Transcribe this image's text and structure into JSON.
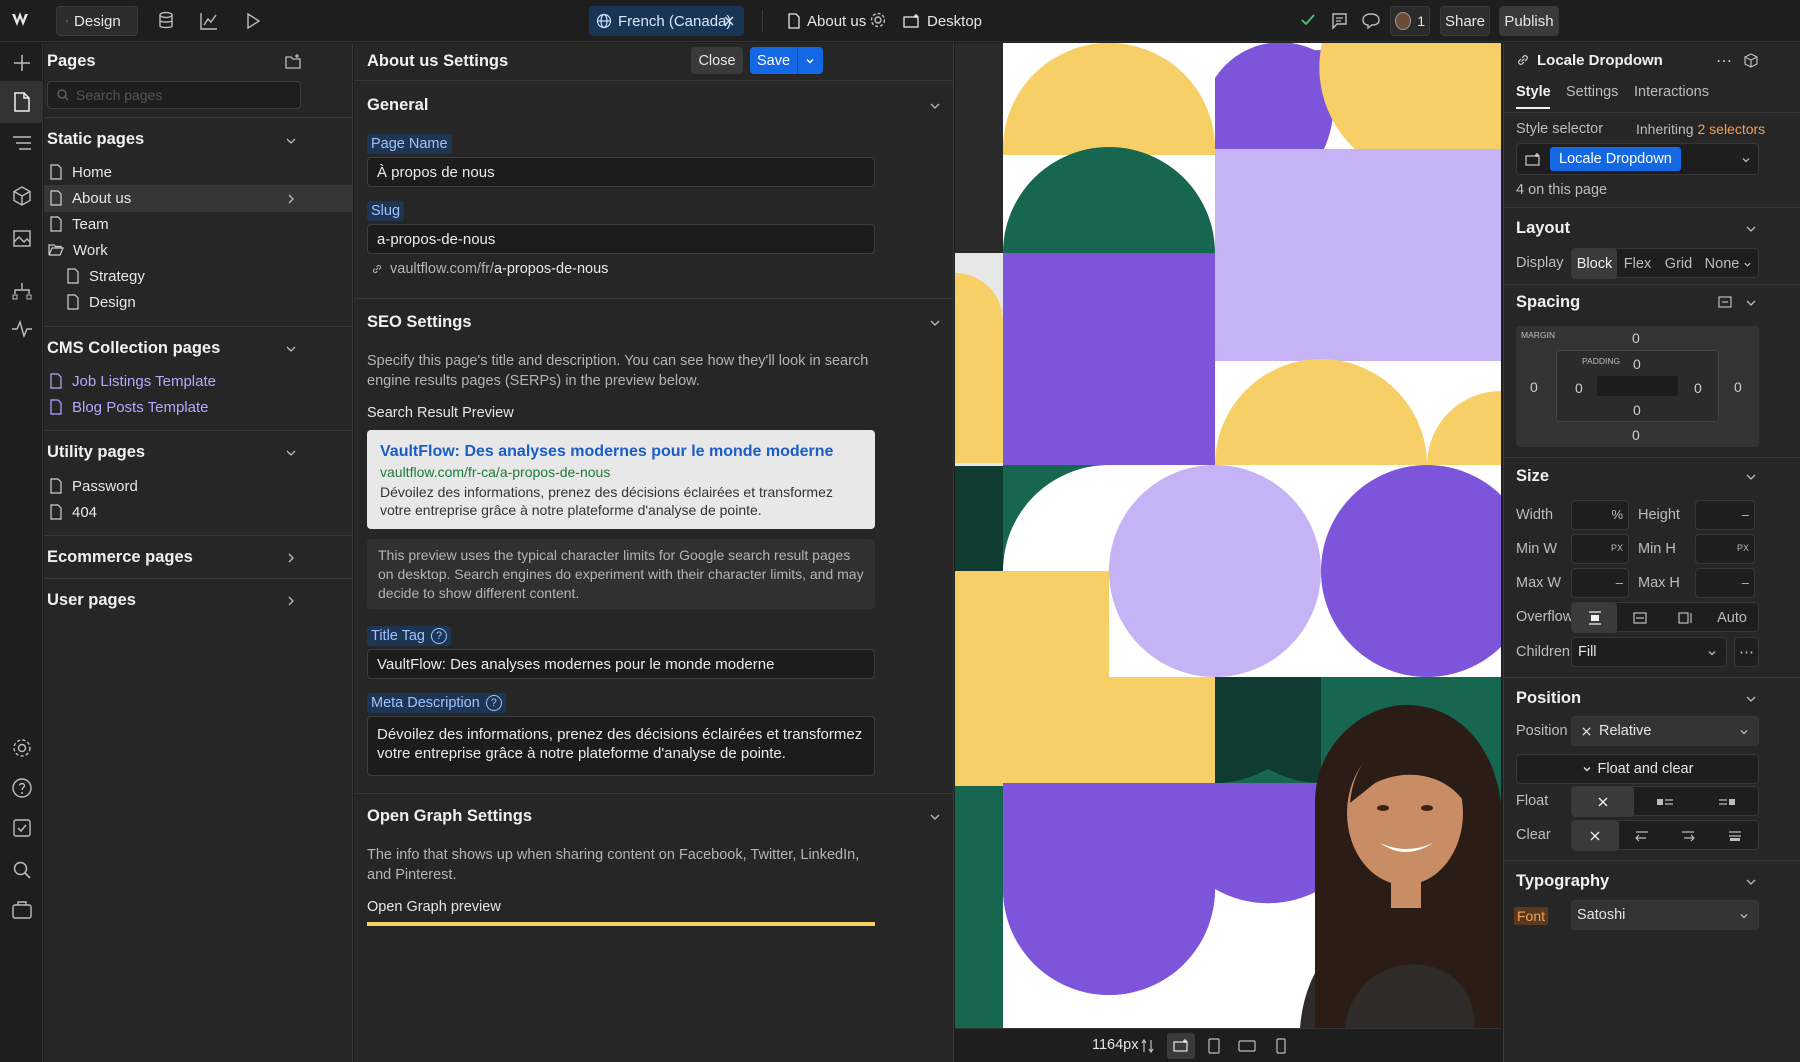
{
  "topbar": {
    "mode_label": "Design",
    "locale_label": "French (Canada)",
    "page_label": "About us",
    "breakpoint_label": "Desktop",
    "user_count": "1",
    "share_label": "Share",
    "publish_label": "Publish"
  },
  "pages": {
    "title": "Pages",
    "search_placeholder": "Search pages",
    "static_title": "Static pages",
    "static_items": [
      "Home",
      "About us",
      "Team",
      "Work",
      "Strategy",
      "Design"
    ],
    "cms_title": "CMS Collection pages",
    "cms_items": [
      "Job Listings Template",
      "Blog Posts Template"
    ],
    "utility_title": "Utility pages",
    "utility_items": [
      "Password",
      "404"
    ],
    "ecommerce_title": "Ecommerce pages",
    "user_title": "User pages"
  },
  "settings": {
    "title": "About us Settings",
    "close_label": "Close",
    "save_label": "Save",
    "general_title": "General",
    "page_name_label": "Page Name",
    "page_name_value": "À propos de nous",
    "slug_label": "Slug",
    "slug_value": "a-propos-de-nous",
    "url_prefix": "vaultflow.com/fr/",
    "url_slug": "a-propos-de-nous",
    "seo_title": "SEO Settings",
    "seo_desc": "Specify this page's title and description. You can see how they'll look in search engine results pages (SERPs) in the preview below.",
    "search_preview_label": "Search Result Preview",
    "serp_title": "VaultFlow: Des analyses modernes pour le monde moderne",
    "serp_url": "vaultflow.com/fr-ca/a-propos-de-nous",
    "serp_desc": "Dévoilez des informations, prenez des décisions éclairées et transformez votre entreprise grâce à notre plateforme d'analyse de pointe.",
    "preview_note": "This preview uses the typical character limits for Google search result pages on desktop. Search engines do experiment with their character limits, and may decide to show different content.",
    "title_tag_label": "Title Tag",
    "title_tag_value": "VaultFlow: Des analyses modernes pour le monde moderne",
    "meta_label": "Meta Description",
    "meta_value": "Dévoilez des informations, prenez des décisions éclairées et transformez votre entreprise grâce à notre plateforme d'analyse de pointe.",
    "og_title": "Open Graph Settings",
    "og_desc": "The info that shows up when sharing content on Facebook, Twitter, LinkedIn, and Pinterest.",
    "og_preview_label": "Open Graph preview"
  },
  "canvas": {
    "width_readout": "1164px",
    "colors": {
      "yellow": "#f6cf66",
      "purple": "#7d55db",
      "lilac": "#c6b3f6",
      "green": "#17664f",
      "darkgreen": "#0f3b31",
      "white": "#ffffff"
    }
  },
  "style": {
    "element_name": "Locale Dropdown",
    "tabs": [
      "Style",
      "Settings",
      "Interactions"
    ],
    "selector_label": "Style selector",
    "inheriting_prefix": "Inheriting",
    "inheriting_count": "2 selectors",
    "selector_chip": "Locale Dropdown",
    "on_page": "4 on this page",
    "layout_title": "Layout",
    "display_label": "Display",
    "display_options": [
      "Block",
      "Flex",
      "Grid",
      "None"
    ],
    "spacing_title": "Spacing",
    "margin_label": "MARGIN",
    "padding_label": "PADDING",
    "zero": "0",
    "size_title": "Size",
    "width_label": "Width",
    "height_label": "Height",
    "minw_label": "Min W",
    "minh_label": "Min H",
    "maxw_label": "Max W",
    "maxh_label": "Max H",
    "percent_unit": "%",
    "px_unit": "PX",
    "dash_unit": "–",
    "overflow_label": "Overflow",
    "overflow_auto": "Auto",
    "children_label": "Children",
    "children_value": "Fill",
    "position_title": "Position",
    "position_label": "Position",
    "position_value": "Relative",
    "float_clear_label": "Float and clear",
    "float_label": "Float",
    "clear_label": "Clear",
    "typography_title": "Typography",
    "font_label": "Font",
    "font_value": "Satoshi"
  }
}
